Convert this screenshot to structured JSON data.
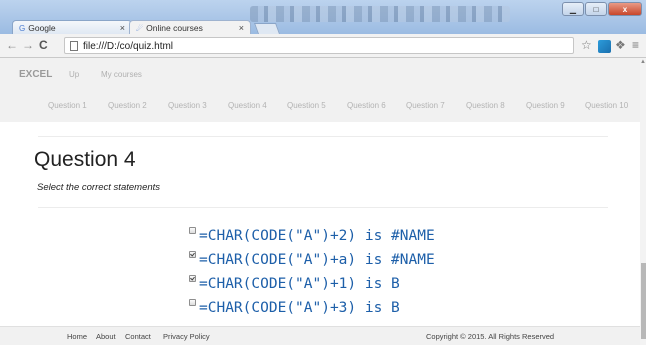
{
  "browser": {
    "tabs": [
      {
        "label": "Google",
        "icon": "google-icon"
      },
      {
        "label": "Online courses",
        "icon": "page-icon"
      }
    ],
    "url": "file:///D:/co/quiz.html",
    "window_controls": {
      "minimize": "▁",
      "maximize": "□",
      "close": "x"
    }
  },
  "site": {
    "brand": "EXCEL",
    "menu": [
      "Up",
      "My courses"
    ],
    "questions": [
      "Question 1",
      "Question 2",
      "Question 3",
      "Question 4",
      "Question 5",
      "Question 6",
      "Question 7",
      "Question 8",
      "Question 9",
      "Question 10"
    ]
  },
  "quiz": {
    "title": "Question 4",
    "instruction": "Select the correct statements",
    "options": [
      {
        "text": "=CHAR(CODE(\"A\")+2) is #NAME",
        "checked": false
      },
      {
        "text": "=CHAR(CODE(\"A\")+a) is #NAME",
        "checked": true
      },
      {
        "text": "=CHAR(CODE(\"A\")+1) is B",
        "checked": true
      },
      {
        "text": "=CHAR(CODE(\"A\")+3) is B",
        "checked": false
      }
    ]
  },
  "footer": {
    "links": [
      "Home",
      "About",
      "Contact",
      "Privacy Policy"
    ],
    "copyright": "Copyright © 2015. All Rights Reserved"
  }
}
